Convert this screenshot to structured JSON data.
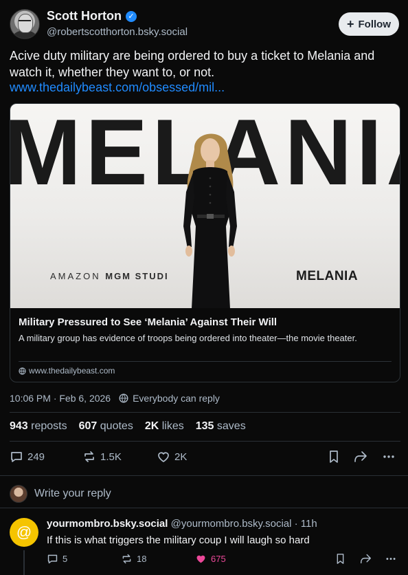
{
  "author": {
    "name": "Scott Horton",
    "handle": "@robertscotthorton.bsky.social",
    "follow_label": "Follow"
  },
  "post": {
    "text": "Acive duty military are being ordered to buy a ticket to Melania and watch it, whether they want to, or not.",
    "link": "www.thedailybeast.com/obsessed/mil..."
  },
  "card": {
    "image_big_word": "MELANIA",
    "image_brand_left_thin": "AMAZON ",
    "image_brand_left_bold": "MGM STUDI",
    "image_brand_right": "MELANIA",
    "title": "Military Pressured to See ‘Melania’ Against Their Will",
    "description": "A military group has evidence of troops being ordered into theater—the movie theater.",
    "domain": "www.thedailybeast.com"
  },
  "meta": {
    "timestamp": "10:06 PM · Feb 6, 2026",
    "reply_setting": "Everybody can reply"
  },
  "stats": {
    "reposts_count": "943",
    "reposts_label": "reposts",
    "quotes_count": "607",
    "quotes_label": "quotes",
    "likes_count": "2K",
    "likes_label": "likes",
    "saves_count": "135",
    "saves_label": "saves"
  },
  "actions": {
    "replies": "249",
    "reposts": "1.5K",
    "likes": "2K"
  },
  "reply_prompt": "Write your reply",
  "reply": {
    "name": "yourmombro.bsky.social",
    "handle_time": "@yourmombro.bsky.social · 11h",
    "text": "If this is what triggers the military coup I will laugh so hard",
    "replies": "5",
    "reposts": "18",
    "likes": "675"
  },
  "colors": {
    "background": "#0a0a0a",
    "link": "#208bfe",
    "muted": "#aebbc9",
    "like_active": "#ec4899",
    "reply_avatar": "#f5c400"
  }
}
